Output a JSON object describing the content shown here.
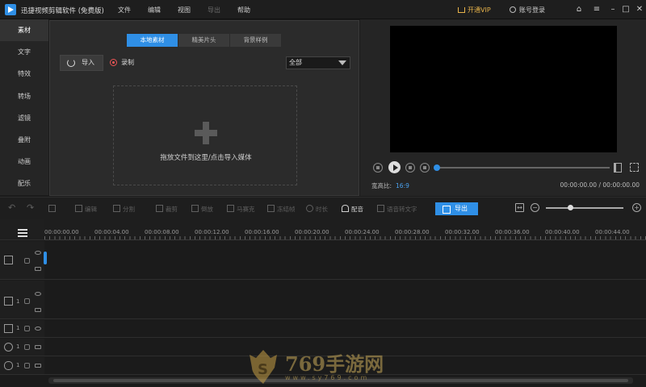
{
  "app": {
    "title": "迅捷视频剪辑软件 (免费版)",
    "menu": [
      {
        "label": "文件",
        "enabled": true
      },
      {
        "label": "编辑",
        "enabled": true
      },
      {
        "label": "视图",
        "enabled": true
      },
      {
        "label": "导出",
        "enabled": false
      },
      {
        "label": "帮助",
        "enabled": true
      }
    ],
    "vip_label": "开通VIP",
    "login_label": "账号登录"
  },
  "sidebar": {
    "items": [
      {
        "label": "素材",
        "active": true
      },
      {
        "label": "文字"
      },
      {
        "label": "特效"
      },
      {
        "label": "转场"
      },
      {
        "label": "滤镜"
      },
      {
        "label": "叠附"
      },
      {
        "label": "动画"
      },
      {
        "label": "配乐"
      }
    ]
  },
  "media": {
    "tabs": [
      {
        "label": "本地素材",
        "active": true
      },
      {
        "label": "精美片头"
      },
      {
        "label": "背景样例"
      }
    ],
    "import_label": "导入",
    "record_label": "录制",
    "filter_selected": "全部",
    "dropzone_text": "拖放文件到这里/点击导入媒体"
  },
  "preview": {
    "aspect_label": "宽高比:",
    "aspect_value": "16:9",
    "timecode": "00:00:00.00 / 00:00:00.00",
    "progress": 0
  },
  "toolbar": {
    "tools": [
      {
        "label": "编辑",
        "enabled": false
      },
      {
        "label": "分割",
        "enabled": false
      },
      {
        "label": "裁剪",
        "enabled": false
      },
      {
        "label": "倒放",
        "enabled": false
      },
      {
        "label": "马赛克",
        "enabled": false
      },
      {
        "label": "冻结帧",
        "enabled": false
      },
      {
        "label": "时长",
        "enabled": false
      },
      {
        "label": "配音",
        "enabled": true
      },
      {
        "label": "语音转文字",
        "enabled": false
      }
    ],
    "export_label": "导出",
    "zoom_level": 0.31
  },
  "timeline": {
    "ruler_labels": [
      "00:00:00.00",
      "00:00:04.00",
      "00:00:08.00",
      "00:00:12.00",
      "00:00:16.00",
      "00:00:20.00",
      "00:00:24.00",
      "00:00:28.00",
      "00:00:32.00",
      "00:00:36.00",
      "00:00:40.00",
      "00:00:44.00"
    ],
    "tracks": [
      {
        "type": "video",
        "icon": "film-icon",
        "number": ""
      },
      {
        "type": "overlay",
        "icon": "picture-in-picture-icon",
        "number": "1"
      },
      {
        "type": "text",
        "icon": "text-icon",
        "number": "1"
      },
      {
        "type": "music",
        "icon": "music-icon",
        "number": "1"
      },
      {
        "type": "voice",
        "icon": "microphone-icon",
        "number": "1"
      }
    ]
  },
  "watermark": {
    "title": "769手游网",
    "url": "www.sy769.com"
  },
  "colors": {
    "accent": "#2f8fe6",
    "vip": "#e7b34a",
    "background": "#1b1b1b"
  }
}
